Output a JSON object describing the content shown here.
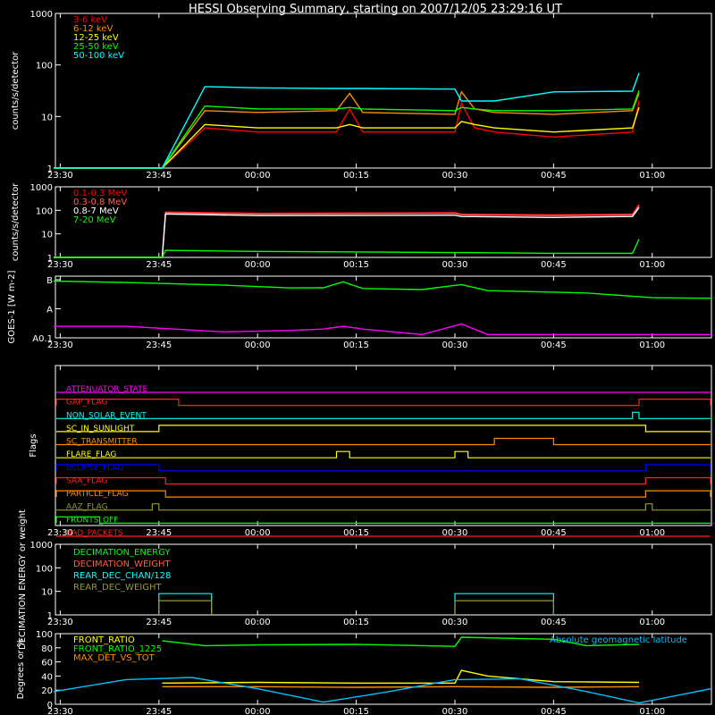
{
  "title": "HESSI Observing Summary, starting on 2007/12/05 23:29:16 UT",
  "time_axis": {
    "start": "23:29:16",
    "end": "01:09:00",
    "ticks": [
      "23:30",
      "23:45",
      "00:00",
      "00:15",
      "00:30",
      "00:45",
      "01:00"
    ]
  },
  "chart_data": [
    {
      "id": "panel1",
      "type": "line",
      "title": "",
      "ylabel": "counts/s/detector",
      "yscale": "log",
      "ylim": [
        1,
        1000
      ],
      "yticks": [
        "1",
        "10",
        "100",
        "1000"
      ],
      "legend_position": "top-left",
      "x": [
        "23:29",
        "23:45:30",
        "23:52",
        "00:00",
        "00:12",
        "00:14",
        "00:16",
        "00:30",
        "00:31",
        "00:33",
        "00:36",
        "00:45",
        "00:57",
        "00:58"
      ],
      "series": [
        {
          "name": "3-6 keV",
          "color": "#ff0000",
          "values": [
            1,
            1,
            6,
            5,
            5,
            14,
            5,
            5,
            18,
            6,
            5,
            4,
            5,
            20
          ]
        },
        {
          "name": "6-12 keV",
          "color": "#ff8c00",
          "values": [
            1,
            1,
            13,
            12,
            13,
            28,
            12,
            11,
            30,
            14,
            12,
            11,
            13,
            28
          ]
        },
        {
          "name": "12-25 keV",
          "color": "#ffff00",
          "values": [
            1,
            1,
            7,
            6,
            6,
            7,
            6,
            6,
            8,
            7,
            6,
            5,
            6,
            15
          ]
        },
        {
          "name": "25-50 keV",
          "color": "#00ff00",
          "values": [
            1,
            1,
            16,
            14,
            14,
            15,
            14,
            13,
            15,
            14,
            13,
            13,
            14,
            32
          ]
        },
        {
          "name": "50-100 keV",
          "color": "#00ffff",
          "values": [
            1,
            1,
            38,
            36,
            35,
            35,
            35,
            34,
            20,
            20,
            20,
            30,
            31,
            70
          ]
        }
      ]
    },
    {
      "id": "panel2",
      "type": "line",
      "title": "",
      "ylabel": "counts/s/detector",
      "yscale": "log",
      "ylim": [
        1,
        1000
      ],
      "yticks": [
        "1",
        "10",
        "100",
        "1000"
      ],
      "legend_position": "top-left",
      "x": [
        "23:29",
        "23:45:30",
        "23:46",
        "00:00",
        "00:30",
        "00:31",
        "00:45",
        "00:57",
        "00:58"
      ],
      "series": [
        {
          "name": "0.1-0.3 MeV",
          "color": "#ff0000",
          "values": [
            1,
            1,
            85,
            75,
            80,
            70,
            65,
            70,
            180
          ]
        },
        {
          "name": "0.3-0.8 MeV",
          "color": "#ff6060",
          "values": [
            1,
            1,
            80,
            70,
            75,
            65,
            60,
            65,
            160
          ]
        },
        {
          "name": "0.8-7 MeV",
          "color": "#ffffff",
          "values": [
            1,
            1,
            70,
            60,
            62,
            55,
            50,
            55,
            130
          ]
        },
        {
          "name": "7-20 MeV",
          "color": "#00ff00",
          "values": [
            1,
            1,
            2,
            1.8,
            1.6,
            1.6,
            1.5,
            1.5,
            6
          ]
        }
      ]
    },
    {
      "id": "panel3",
      "type": "line",
      "title": "",
      "ylabel": "GOES-1 [W m-2]",
      "yscale": "log",
      "yticks": [
        "A0.1",
        "A",
        "B"
      ],
      "legend_position": "none",
      "x": [
        "23:29",
        "23:40",
        "23:55",
        "00:05",
        "00:10",
        "00:13",
        "00:16",
        "00:25",
        "00:31",
        "00:35",
        "00:50",
        "01:00",
        "01:09"
      ],
      "series": [
        {
          "name": "",
          "color": "#00ff00",
          "values": [
            9,
            8,
            6.5,
            5.2,
            5.3,
            8.5,
            5,
            4.6,
            6.8,
            4.2,
            3.5,
            2.4,
            2.3
          ]
        },
        {
          "name": "",
          "color": "#ff00ff",
          "values": [
            0.25,
            0.25,
            0.16,
            0.18,
            0.2,
            0.25,
            0.2,
            0.13,
            0.3,
            0.13,
            0.13,
            0.13,
            0.13
          ]
        }
      ]
    },
    {
      "id": "panel4",
      "type": "line",
      "title": "",
      "ylabel": "Flags",
      "legend_position": "inline",
      "flags": [
        {
          "name": "ATTENUATOR_STATE",
          "color": "#ff00ff",
          "high_intervals": []
        },
        {
          "name": "GAP_FLAG",
          "color": "#ff2020",
          "high_intervals": [
            [
              "23:29",
              "23:48"
            ],
            [
              "00:58",
              "01:09"
            ]
          ]
        },
        {
          "name": "NON_SOLAR_EVENT",
          "color": "#00ffff",
          "high_intervals": [
            [
              "00:57",
              "00:58"
            ]
          ]
        },
        {
          "name": "SC_IN_SUNLIGHT",
          "color": "#ffff00",
          "high_intervals": [
            [
              "23:45",
              "00:59"
            ]
          ]
        },
        {
          "name": "SC_TRANSMITTER",
          "color": "#ff8c00",
          "high_intervals": [
            [
              "00:36",
              "00:45"
            ]
          ]
        },
        {
          "name": "FLARE_FLAG",
          "color": "#ffff00",
          "high_intervals": [
            [
              "00:12",
              "00:14"
            ],
            [
              "00:30",
              "00:32"
            ]
          ]
        },
        {
          "name": "ECLIPSE_FLAG",
          "color": "#0000ff",
          "high_intervals": [
            [
              "23:29",
              "23:45"
            ],
            [
              "00:59",
              "01:09"
            ]
          ]
        },
        {
          "name": "SAA_FLAG",
          "color": "#ff2020",
          "high_intervals": [
            [
              "23:29",
              "23:46"
            ],
            [
              "00:59",
              "01:09"
            ]
          ]
        },
        {
          "name": "PARTICLE_FLAG",
          "color": "#ff8c00",
          "high_intervals": [
            [
              "23:29",
              "23:46"
            ],
            [
              "00:59",
              "01:09"
            ]
          ]
        },
        {
          "name": "AAZ_FLAG",
          "color": "#999933",
          "high_intervals": [
            [
              "23:44",
              "23:45"
            ],
            [
              "00:59",
              "01:00"
            ]
          ]
        },
        {
          "name": "FRONTS_OFF",
          "color": "#00ff00",
          "high_intervals": [
            [
              "23:29",
              "23:36"
            ]
          ]
        },
        {
          "name": "BAD_PACKETS",
          "color": "#ff2020",
          "high_intervals": []
        }
      ]
    },
    {
      "id": "panel5",
      "type": "line",
      "title": "",
      "ylabel": "DECIMATION ENERGY or weight",
      "yscale": "log",
      "ylim": [
        1,
        1000
      ],
      "yticks": [
        "1",
        "10",
        "100",
        "1000"
      ],
      "legend_position": "top-left",
      "series": [
        {
          "name": "DECIMATION_ENERGY",
          "color": "#00ff00",
          "segments": []
        },
        {
          "name": "DECIMATION_WEIGHT",
          "color": "#ff6030",
          "segments": []
        },
        {
          "name": "REAR_DEC_CHAN/128",
          "color": "#00ffff",
          "segments": [
            [
              [
                "23:45",
                1
              ],
              [
                "23:45",
                8
              ],
              [
                "23:53",
                8
              ],
              [
                "23:53",
                1
              ]
            ],
            [
              [
                "00:30",
                1
              ],
              [
                "00:30",
                8
              ],
              [
                "00:45",
                8
              ],
              [
                "00:45",
                1
              ]
            ]
          ]
        },
        {
          "name": "REAR_DEC_WEIGHT",
          "color": "#999933",
          "segments": [
            [
              [
                "23:45",
                1
              ],
              [
                "23:45",
                4
              ],
              [
                "23:53",
                4
              ],
              [
                "23:53",
                1
              ]
            ],
            [
              [
                "00:30",
                1
              ],
              [
                "00:30",
                4
              ],
              [
                "00:45",
                4
              ],
              [
                "00:45",
                1
              ]
            ]
          ]
        }
      ]
    },
    {
      "id": "panel6",
      "type": "line",
      "title": "",
      "ylabel": "Degrees or %",
      "ylim": [
        0,
        100
      ],
      "yticks": [
        "0",
        "20",
        "40",
        "60",
        "80",
        "100"
      ],
      "legend_position": "top-left",
      "annotation": "Absolute geomagnetic latitude",
      "series": [
        {
          "name": "FRONT_RATIO",
          "color": "#ffff00",
          "x": [
            "23:45:30",
            "00:00",
            "00:15",
            "00:30",
            "00:31",
            "00:35",
            "00:45",
            "00:58"
          ],
          "values": [
            30,
            31,
            30,
            30,
            48,
            40,
            32,
            31
          ]
        },
        {
          "name": "FRONT_RATIO_1225",
          "color": "#00ff00",
          "x": [
            "23:45:30",
            "23:52",
            "00:00",
            "00:15",
            "00:30",
            "00:31",
            "00:45",
            "00:50",
            "00:58"
          ],
          "values": [
            90,
            83,
            84,
            85,
            82,
            95,
            92,
            83,
            85
          ]
        },
        {
          "name": "MAX_DET_VS_TOT",
          "color": "#ff8c00",
          "x": [
            "23:45:30",
            "00:00",
            "00:15",
            "00:30",
            "00:45",
            "00:58"
          ],
          "values": [
            25,
            25,
            24,
            25,
            24,
            25
          ]
        },
        {
          "name": "",
          "color": "#00bfff",
          "x": [
            "23:29",
            "23:40",
            "23:50",
            "00:00",
            "00:10",
            "00:20",
            "00:30",
            "00:40",
            "00:50",
            "00:58",
            "01:09"
          ],
          "values": [
            18,
            35,
            38,
            22,
            3,
            18,
            35,
            36,
            18,
            2,
            22
          ]
        }
      ]
    }
  ]
}
